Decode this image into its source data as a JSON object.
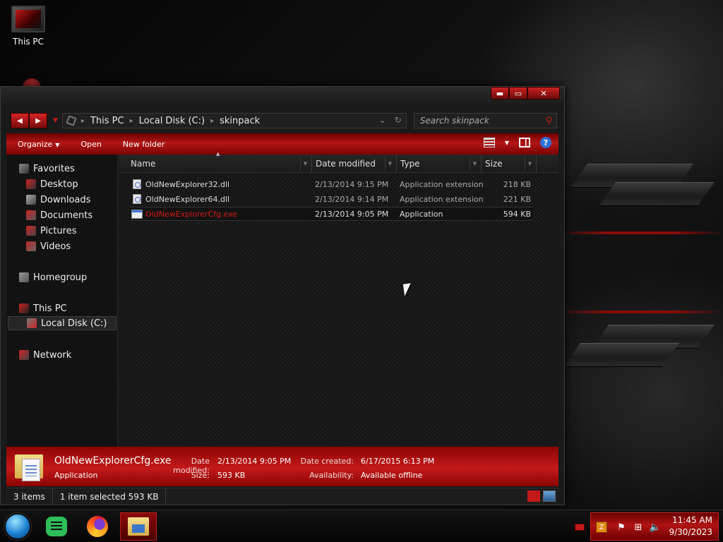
{
  "desktop": {
    "icon_label": "This PC"
  },
  "window": {
    "caption": {
      "minimize": "▬",
      "maximize": "▭",
      "close": "✕"
    },
    "address": {
      "crumbs": [
        "This PC",
        "Local Disk (C:)",
        "skinpack"
      ]
    },
    "search": {
      "placeholder": "Search skinpack"
    },
    "commands": {
      "organize": "Organize",
      "open": "Open",
      "new_folder": "New folder"
    },
    "nav": {
      "favorites": "Favorites",
      "desktop": "Desktop",
      "downloads": "Downloads",
      "documents": "Documents",
      "pictures": "Pictures",
      "videos": "Videos",
      "homegroup": "Homegroup",
      "this_pc": "This PC",
      "local_disk": "Local Disk (C:)",
      "network": "Network"
    },
    "columns": {
      "name": "Name",
      "date": "Date modified",
      "type": "Type",
      "size": "Size"
    },
    "files": [
      {
        "name": "OldNewExplorer32.dll",
        "date": "2/13/2014 9:15 PM",
        "type": "Application extension",
        "size": "218 KB"
      },
      {
        "name": "OldNewExplorer64.dll",
        "date": "2/13/2014 9:14 PM",
        "type": "Application extension",
        "size": "221 KB"
      },
      {
        "name": "OldNewExplorerCfg.exe",
        "date": "2/13/2014 9:05 PM",
        "type": "Application",
        "size": "594 KB"
      }
    ],
    "details": {
      "name": "OldNewExplorerCfg.exe",
      "type": "Application",
      "date_modified_label": "Date modified:",
      "date_modified": "2/13/2014 9:05 PM",
      "size_label": "Size:",
      "size": "593 KB",
      "date_created_label": "Date created:",
      "date_created": "6/17/2015 6:13 PM",
      "availability_label": "Availability:",
      "availability": "Available offline"
    },
    "status": {
      "items": "3 items",
      "selected": "1 item selected  593 KB"
    }
  },
  "taskbar": {
    "time": "11:45 AM",
    "date": "9/30/2023"
  },
  "colors": {
    "accent": "#c21a1a",
    "background": "#0a0a0a"
  }
}
